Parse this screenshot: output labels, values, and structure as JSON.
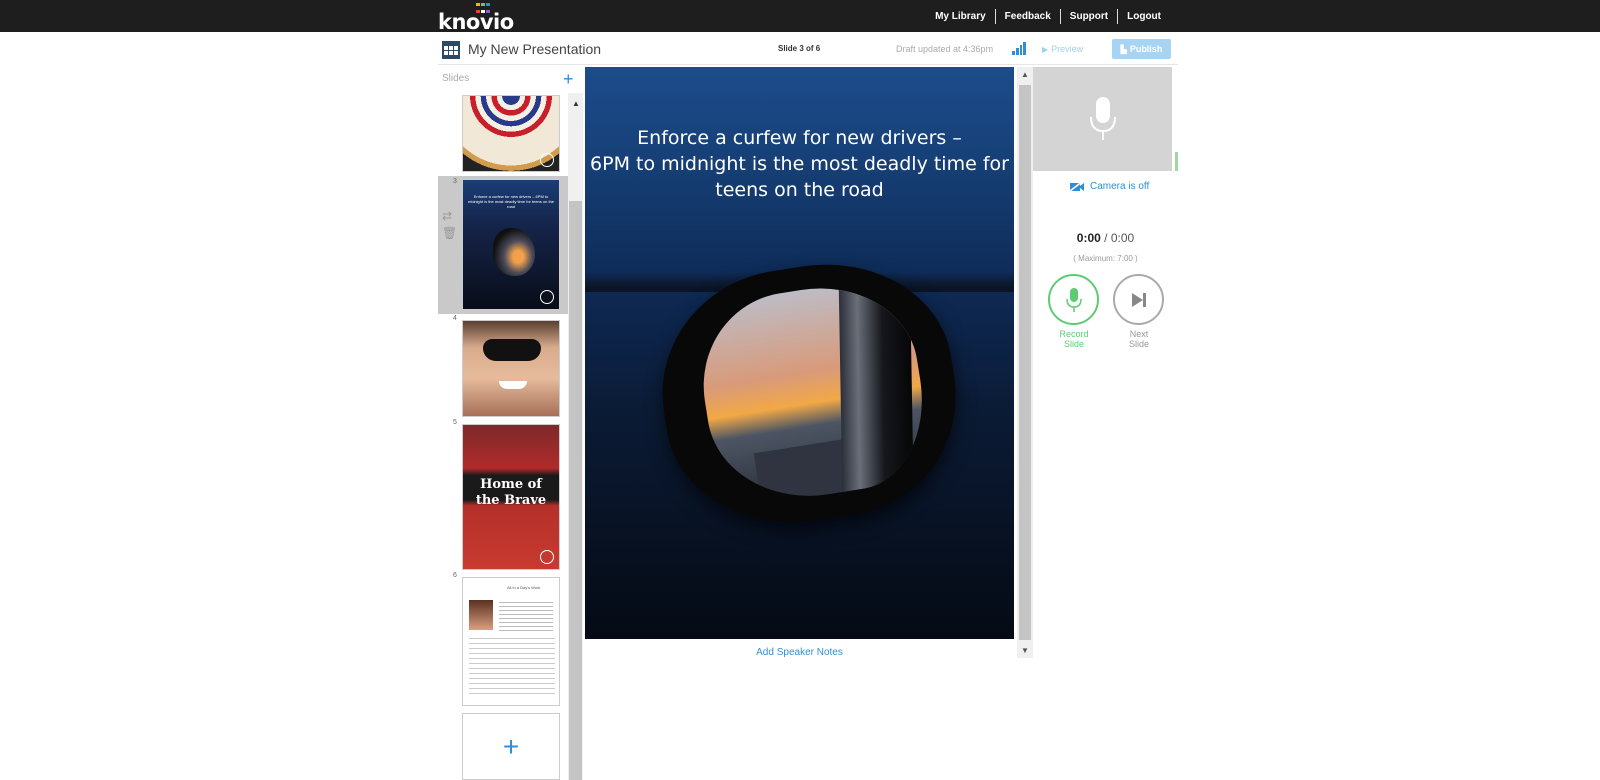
{
  "app": {
    "logo_text": "knovio"
  },
  "nav": {
    "links": [
      "My Library",
      "Feedback",
      "Support",
      "Logout"
    ]
  },
  "header": {
    "title": "My New Presentation",
    "slide_counter": "Slide 3 of 6",
    "draft_status": "Draft updated at 4:36pm",
    "preview_label": "Preview",
    "publish_label": "Publish"
  },
  "slides_panel": {
    "label": "Slides",
    "add_icon": "+",
    "numbers": [
      "3",
      "4",
      "5",
      "6"
    ],
    "thumb_texts": {
      "slide3": "Enforce a curfew for  new drivers – 6PM to midnight is the most deadly time for teens on the road",
      "slide5": "Home of the Brave",
      "slide6_heading": "All in a Day's Work"
    }
  },
  "stage": {
    "text_line1": "Enforce a curfew for  new drivers –",
    "text_line2": "6PM to midnight is the most deadly time for",
    "text_line3": "teens on the road",
    "speaker_notes_label": "Add Speaker Notes"
  },
  "recorder": {
    "camera_status": "Camera is off",
    "elapsed": "0:00",
    "separator": "/",
    "total": "0:00",
    "max_label": "( Maximum: 7:00 )",
    "record_label_1": "Record",
    "record_label_2": "Slide",
    "next_label_1": "Next",
    "next_label_2": "Slide"
  },
  "colors": {
    "accent": "#2f8fd6",
    "record_green": "#5ecb73",
    "topbar": "#1e1e1e"
  },
  "icons": [
    "grid-icon",
    "signal-icon",
    "play-icon",
    "publish-icon",
    "plus-icon",
    "mic-icon",
    "camera-off-icon",
    "skip-next-icon",
    "swap-icon",
    "trash-icon",
    "scroll-up-icon",
    "scroll-down-icon"
  ]
}
